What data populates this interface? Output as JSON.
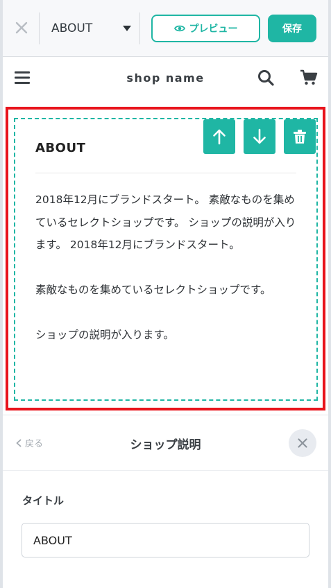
{
  "topbar": {
    "page_select_value": "ABOUT",
    "preview_label": "プレビュー",
    "save_label": "保存"
  },
  "shop": {
    "name": "shop name"
  },
  "section": {
    "title": "ABOUT",
    "paragraphs": [
      "2018年12月にブランドスタート。 素敵なものを集めているセレクトショップです。 ショップの説明が入ります。 2018年12月にブランドスタート。",
      "素敵なものを集めているセレクトショップです。",
      "ショップの説明が入ります。"
    ]
  },
  "panel": {
    "back_label": "戻る",
    "title": "ショップ説明",
    "field_label": "タイトル",
    "field_value": "ABOUT"
  },
  "colors": {
    "accent": "#1fb6a4",
    "selection_outline": "#e8141c"
  },
  "icons": {
    "close": "close-icon",
    "caret": "caret-down-icon",
    "preview": "eye-icon",
    "menu": "hamburger-icon",
    "search": "search-icon",
    "cart": "cart-icon",
    "move_up": "arrow-up-icon",
    "move_down": "arrow-down-icon",
    "delete": "trash-icon",
    "back": "chevron-left-icon"
  }
}
